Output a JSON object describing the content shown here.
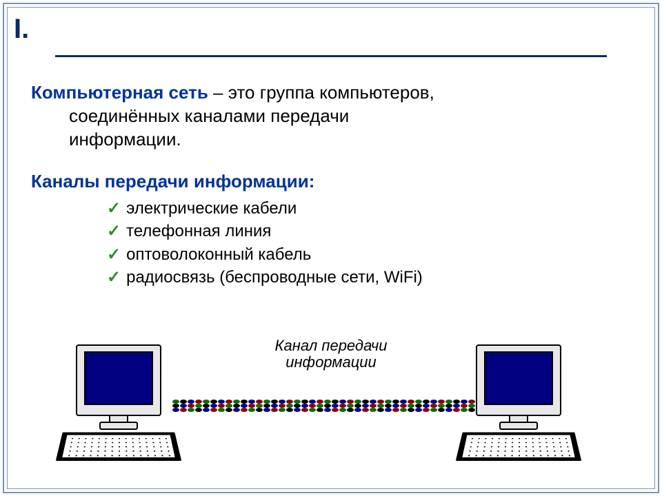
{
  "roman_numeral": "I.",
  "definition": {
    "term": "Компьютерная сеть",
    "dash": " – ",
    "text_line1": "это группа компьютеров,",
    "text_line2": "соединённых каналами передачи",
    "text_line3": "информации."
  },
  "channels_heading": "Каналы передачи информации:",
  "channels": [
    "электрические кабели",
    "телефонная линия",
    "оптоволоконный кабель",
    "радиосвязь (беспроводные сети, WiFi)"
  ],
  "diagram_caption_line1": "Канал передачи",
  "diagram_caption_line2": "информации",
  "cable_colors": [
    "#0a6b0a",
    "#000000",
    "#00008b",
    "#8b0000"
  ]
}
